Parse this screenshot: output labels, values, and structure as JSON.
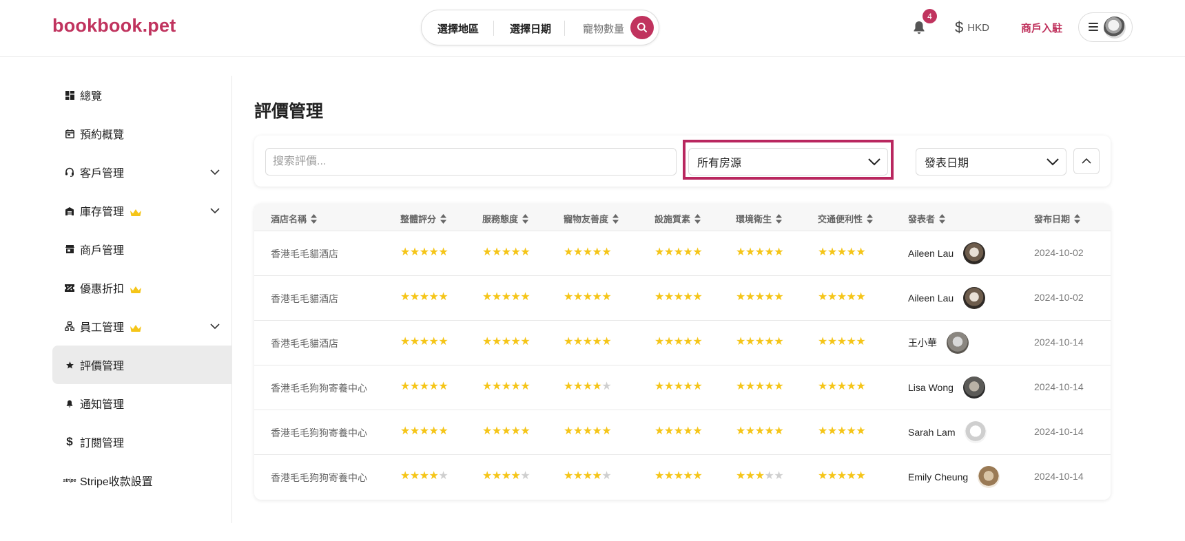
{
  "header": {
    "logo": "bookbook.pet",
    "search": {
      "region": "選擇地區",
      "date": "選擇日期",
      "pets": "寵物數量"
    },
    "notification_count": "4",
    "currency": "HKD",
    "merchant_link": "商戶入駐",
    "accent_color": "#c0335e"
  },
  "sidebar": {
    "items": [
      {
        "label": "總覽",
        "icon": "dashboard-icon"
      },
      {
        "label": "預約概覽",
        "icon": "calendar-icon"
      },
      {
        "label": "客戶管理",
        "icon": "headset-icon",
        "expandable": true
      },
      {
        "label": "庫存管理",
        "icon": "warehouse-icon",
        "premium": true,
        "expandable": true
      },
      {
        "label": "商戶管理",
        "icon": "store-icon"
      },
      {
        "label": "優惠折扣",
        "icon": "ticket-icon",
        "premium": true
      },
      {
        "label": "員工管理",
        "icon": "org-chart-icon",
        "premium": true,
        "expandable": true
      },
      {
        "label": "評價管理",
        "icon": "star-icon",
        "active": true
      },
      {
        "label": "通知管理",
        "icon": "bell-icon"
      },
      {
        "label": "訂閱管理",
        "icon": "dollar-icon"
      },
      {
        "label": "Stripe收款設置",
        "icon": "stripe-icon"
      }
    ]
  },
  "main": {
    "title": "評價管理",
    "filters": {
      "search_placeholder": "搜索評價...",
      "property_select": "所有房源",
      "sort_select": "發表日期"
    },
    "table": {
      "headers": [
        "酒店名稱",
        "整體評分",
        "服務態度",
        "寵物友善度",
        "設施質素",
        "環境衛生",
        "交通便利性",
        "發表者",
        "發布日期"
      ],
      "rows": [
        {
          "hotel": "香港毛毛貓酒店",
          "ratings": [
            5,
            5,
            5,
            5,
            5,
            5
          ],
          "reviewer": "Aileen Lau",
          "date": "2024-10-02"
        },
        {
          "hotel": "香港毛毛貓酒店",
          "ratings": [
            5,
            5,
            5,
            5,
            5,
            5
          ],
          "reviewer": "Aileen Lau",
          "date": "2024-10-02"
        },
        {
          "hotel": "香港毛毛貓酒店",
          "ratings": [
            5,
            5,
            5,
            5,
            5,
            5
          ],
          "reviewer": "王小華",
          "date": "2024-10-14"
        },
        {
          "hotel": "香港毛毛狗狗寄養中心",
          "ratings": [
            5,
            5,
            4,
            5,
            5,
            5
          ],
          "reviewer": "Lisa Wong",
          "date": "2024-10-14"
        },
        {
          "hotel": "香港毛毛狗狗寄養中心",
          "ratings": [
            5,
            5,
            5,
            5,
            5,
            5
          ],
          "reviewer": "Sarah Lam",
          "date": "2024-10-14"
        },
        {
          "hotel": "香港毛毛狗狗寄養中心",
          "ratings": [
            4,
            4,
            4,
            5,
            3,
            5
          ],
          "reviewer": "Emily Cheung",
          "date": "2024-10-14"
        }
      ]
    }
  }
}
